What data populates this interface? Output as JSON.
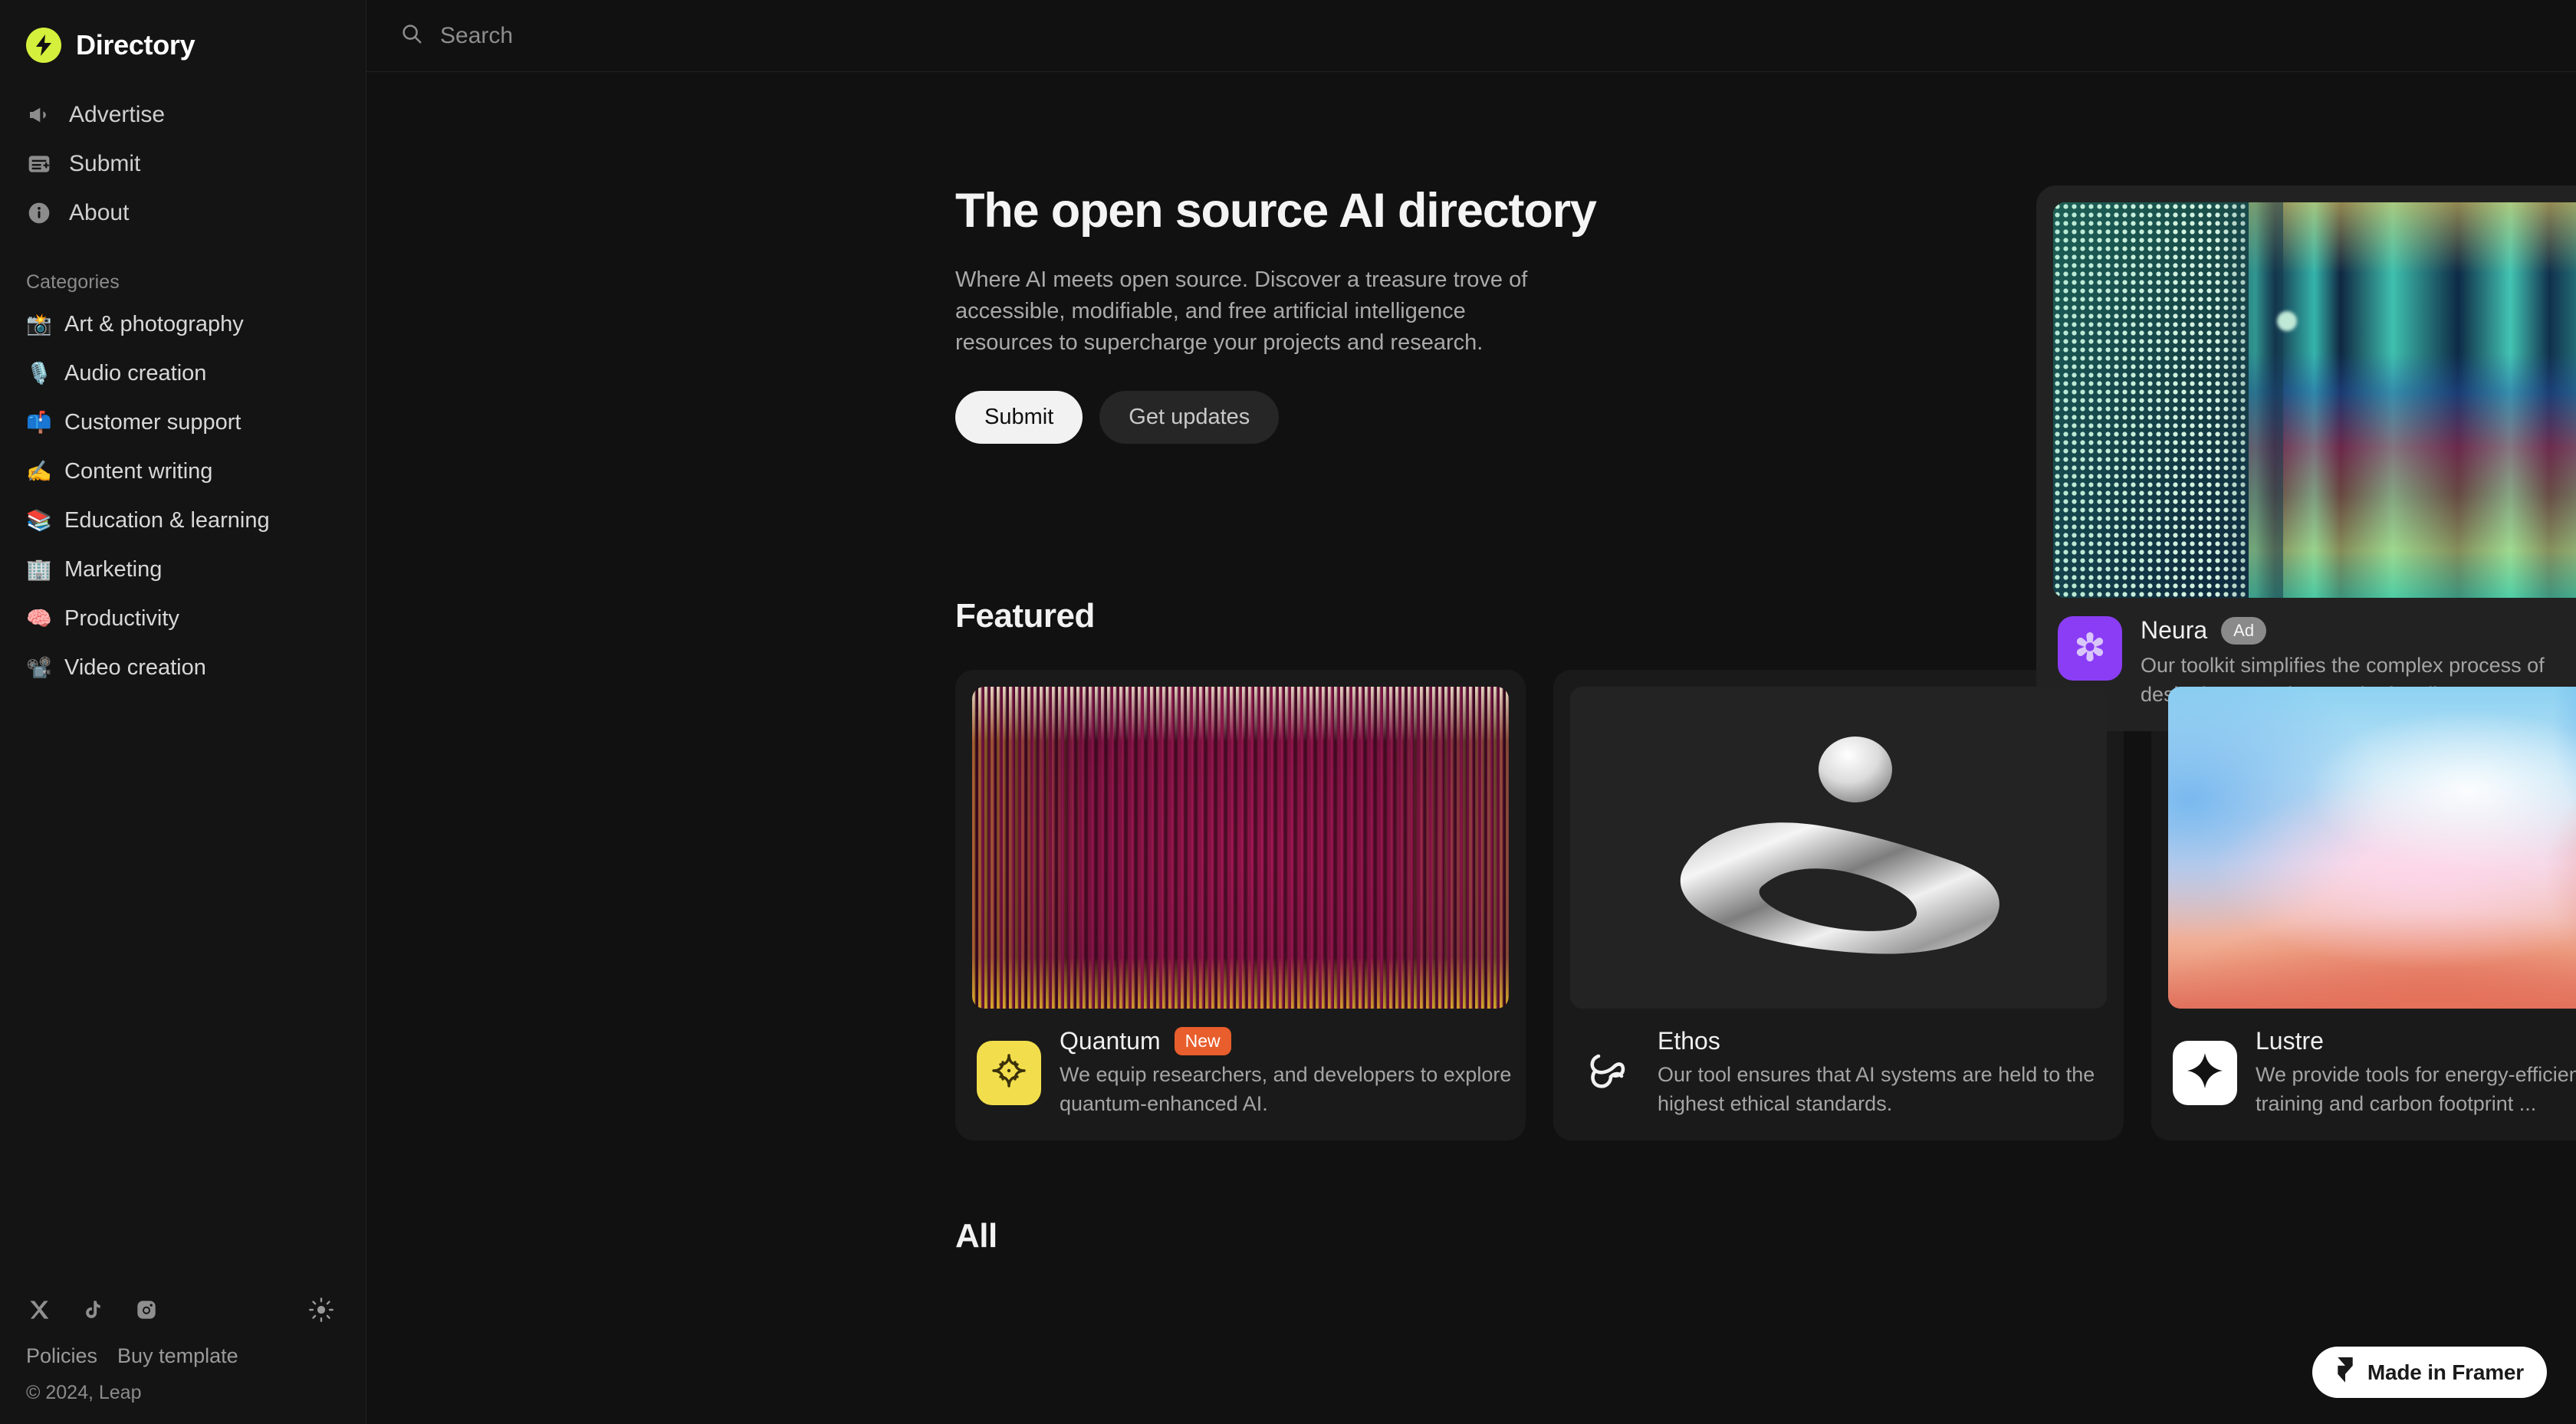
{
  "brand": {
    "name": "Directory",
    "logo_icon": "lightning-bolt-icon",
    "logo_color": "#d4f03c"
  },
  "search": {
    "placeholder": "Search",
    "icon": "search-icon"
  },
  "sidebar": {
    "nav": [
      {
        "label": "Advertise",
        "icon": "megaphone-icon"
      },
      {
        "label": "Submit",
        "icon": "form-plus-icon"
      },
      {
        "label": "About",
        "icon": "info-circle-icon"
      }
    ],
    "categories_title": "Categories",
    "categories": [
      {
        "label": "Art & photography",
        "emoji": "📸"
      },
      {
        "label": "Audio creation",
        "emoji": "🎙️"
      },
      {
        "label": "Customer support",
        "emoji": "📫"
      },
      {
        "label": "Content writing",
        "emoji": "✍️"
      },
      {
        "label": "Education & learning",
        "emoji": "📚"
      },
      {
        "label": "Marketing",
        "emoji": "🏢"
      },
      {
        "label": "Productivity",
        "emoji": "🧠"
      },
      {
        "label": "Video creation",
        "emoji": "📽️"
      }
    ],
    "socials": [
      {
        "name": "x-twitter-icon"
      },
      {
        "name": "tiktok-icon"
      },
      {
        "name": "instagram-icon"
      }
    ],
    "theme_toggle_icon": "sun-icon",
    "footer_links": [
      "Policies",
      "Buy template"
    ],
    "copyright": "© 2024, Leap"
  },
  "hero": {
    "title": "The open source AI directory",
    "description": "Where AI meets open source. Discover a treasure trove of accessible, modifiable, and free artificial intelligence resources to supercharge your projects and research.",
    "primary_button": "Submit",
    "secondary_button": "Get updates"
  },
  "ad": {
    "name": "Neura",
    "badge": "Ad",
    "description": "Our toolkit simplifies the complex process of designing neural networks for all.",
    "logo_icon": "pinwheel-icon",
    "logo_color": "#8b3df5",
    "image_alt": "abstract led panel with rainbow color bands"
  },
  "sections": {
    "featured_title": "Featured",
    "all_title": "All"
  },
  "featured": [
    {
      "name": "Quantum",
      "badge": "New",
      "badge_color": "#e85e2c",
      "description": "We equip researchers, and developers to explore quantum-enhanced AI.",
      "logo_icon": "quantum-atom-icon",
      "logo_bg": "#f2de4c",
      "image_alt": "vertical striped magenta and gold abstract texture"
    },
    {
      "name": "Ethos",
      "badge": "",
      "description": "Our tool ensures that AI systems are held to the highest ethical standards.",
      "logo_icon": "knot-loop-icon",
      "logo_bg": "transparent",
      "image_alt": "3d metallic organic ring with floating sphere"
    },
    {
      "name": "Lustre",
      "badge": "",
      "description": "We provide tools for energy-efficient model training and carbon footprint ...",
      "logo_icon": "sparkle-icon",
      "logo_bg": "#ffffff",
      "image_alt": "soft blue pink and coral mesh gradient"
    }
  ],
  "framer_badge": {
    "label": "Made in Framer",
    "icon": "framer-logo-icon"
  }
}
